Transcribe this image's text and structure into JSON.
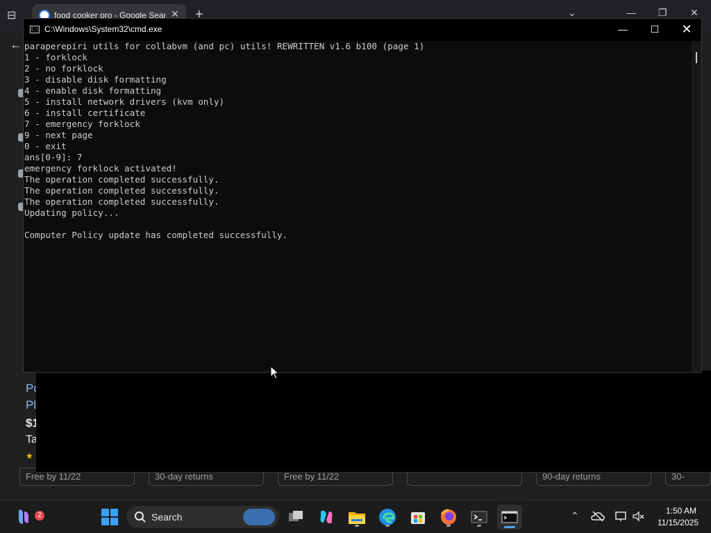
{
  "browser": {
    "tab_title": "food cooker pro - Google Searc",
    "product": {
      "link_line1": "Po",
      "link_line2": "Pl",
      "price": "$1",
      "store": "Ta",
      "star": "★"
    },
    "chips": [
      "Free by 11/22",
      "30-day returns",
      "Free by 11/22",
      "",
      "90-day returns",
      "30-"
    ]
  },
  "cmd": {
    "window_title": "C:\\Windows\\System32\\cmd.exe",
    "lines": [
      "paraperepiri utils for collabvm (and pc) utils! REWRITTEN v1.6 b100 (page 1)",
      "1 - forklock",
      "2 - no forklock",
      "3 - disable disk formatting",
      "4 - enable disk formatting",
      "5 - install network drivers (kvm only)",
      "6 - install certificate",
      "7 - emergency forklock",
      "9 - next page",
      "0 - exit",
      "ans[0-9]: 7",
      "emergency forklock activated!",
      "The operation completed successfully.",
      "The operation completed successfully.",
      "The operation completed successfully.",
      "Updating policy...",
      "",
      "Computer Policy update has completed successfully."
    ]
  },
  "taskbar": {
    "search_label": "Search",
    "notification_badge": "2",
    "time": "1:50 AM",
    "date": "11/15/2025",
    "icons": [
      "copilot-icon",
      "windows-start-icon",
      "search-icon",
      "task-view-icon",
      "copilot-app-icon",
      "file-explorer-icon",
      "edge-icon",
      "store-icon",
      "firefox-icon",
      "terminal-icon",
      "cmd-icon"
    ]
  }
}
